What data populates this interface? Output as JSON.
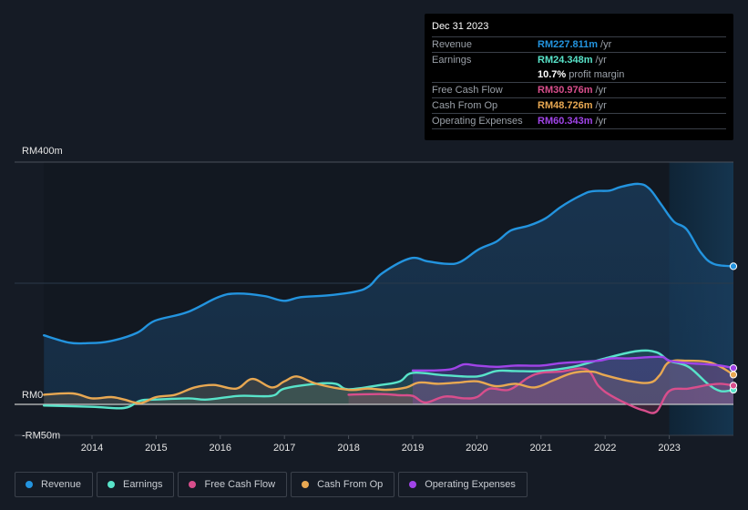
{
  "chart_data": {
    "type": "area",
    "title": "",
    "xlabel": "",
    "ylabel": "",
    "y_ticks": [
      {
        "value": 400,
        "label": "RM400m"
      },
      {
        "value": 0,
        "label": "RM0"
      },
      {
        "value": -50,
        "label": "-RM50m"
      }
    ],
    "ylim": [
      -50,
      400
    ],
    "xlim": [
      2013.3,
      2024.0
    ],
    "x_ticks": [
      "2014",
      "2015",
      "2016",
      "2017",
      "2018",
      "2019",
      "2020",
      "2021",
      "2022",
      "2023"
    ],
    "forecast_region_start": 2023.0,
    "grid": true,
    "legend_position": "bottom-left",
    "series": [
      {
        "name": "Revenue",
        "color": "#2394df",
        "x": [
          2013.25,
          2013.64,
          2013.92,
          2014.27,
          2014.7,
          2014.98,
          2015.48,
          2015.97,
          2016.26,
          2016.68,
          2016.99,
          2017.25,
          2017.68,
          2018.1,
          2018.32,
          2018.53,
          2018.96,
          2019.24,
          2019.53,
          2019.74,
          2020.03,
          2020.31,
          2020.53,
          2020.81,
          2021.07,
          2021.31,
          2021.64,
          2021.81,
          2022.07,
          2022.24,
          2022.52,
          2022.69,
          2022.88,
          2023.07,
          2023.27,
          2023.49,
          2023.69,
          2024.0
        ],
        "values": [
          114,
          102,
          101,
          104,
          118,
          138,
          152,
          177,
          183,
          179,
          171,
          177,
          180,
          186,
          195,
          217,
          241,
          236,
          232,
          235,
          256,
          269,
          287,
          295,
          307,
          326,
          346,
          352,
          353,
          359,
          364,
          356,
          329,
          302,
          289,
          251,
          232,
          228
        ]
      },
      {
        "name": "Earnings",
        "color": "#58e3c9",
        "x": [
          2013.25,
          2014.0,
          2014.5,
          2014.75,
          2015.0,
          2015.5,
          2015.8,
          2016.3,
          2016.8,
          2017.0,
          2017.5,
          2017.8,
          2018.0,
          2018.5,
          2018.8,
          2019.0,
          2019.5,
          2020.0,
          2020.3,
          2020.6,
          2021.0,
          2021.5,
          2022.0,
          2022.5,
          2022.8,
          2023.0,
          2023.3,
          2023.6,
          2023.8,
          2024.0
        ],
        "values": [
          -2,
          -4,
          -6,
          6,
          8,
          10,
          8,
          14,
          14,
          26,
          34,
          34,
          25,
          32,
          38,
          52,
          48,
          46,
          55,
          55,
          55,
          62,
          76,
          88,
          86,
          72,
          62,
          34,
          22,
          24
        ]
      },
      {
        "name": "Free Cash Flow",
        "color": "#d84e8c",
        "x": [
          2018.0,
          2018.5,
          2018.8,
          2019.0,
          2019.2,
          2019.5,
          2019.8,
          2020.0,
          2020.2,
          2020.5,
          2020.8,
          2021.0,
          2021.3,
          2021.7,
          2021.9,
          2022.1,
          2022.4,
          2022.6,
          2022.8,
          2023.0,
          2023.3,
          2023.6,
          2023.8,
          2024.0
        ],
        "values": [
          16,
          17,
          15,
          14,
          3,
          13,
          10,
          12,
          26,
          24,
          44,
          52,
          54,
          58,
          30,
          14,
          -2,
          -10,
          -12,
          22,
          26,
          32,
          34,
          31
        ]
      },
      {
        "name": "Cash From Op",
        "color": "#e8a852",
        "x": [
          2013.25,
          2013.7,
          2014.0,
          2014.3,
          2014.5,
          2014.75,
          2015.0,
          2015.3,
          2015.6,
          2015.9,
          2016.25,
          2016.5,
          2016.8,
          2017.0,
          2017.2,
          2017.5,
          2018.0,
          2018.3,
          2018.6,
          2018.9,
          2019.1,
          2019.4,
          2019.7,
          2020.0,
          2020.3,
          2020.6,
          2020.9,
          2021.2,
          2021.5,
          2021.8,
          2022.0,
          2022.4,
          2022.7,
          2022.85,
          2023.0,
          2023.3,
          2023.6,
          2023.8,
          2024.0
        ],
        "values": [
          16,
          18,
          10,
          12,
          8,
          2,
          12,
          16,
          28,
          32,
          26,
          42,
          28,
          38,
          46,
          34,
          24,
          26,
          24,
          28,
          36,
          34,
          36,
          38,
          30,
          34,
          28,
          40,
          52,
          54,
          48,
          38,
          36,
          48,
          70,
          72,
          70,
          62,
          49
        ]
      },
      {
        "name": "Operating Expenses",
        "color": "#a044e8",
        "x": [
          2019.0,
          2019.3,
          2019.6,
          2019.8,
          2020.0,
          2020.3,
          2020.6,
          2021.0,
          2021.3,
          2021.6,
          2021.9,
          2022.1,
          2022.4,
          2022.7,
          2022.9,
          2023.0,
          2023.3,
          2023.6,
          2023.8,
          2024.0
        ],
        "values": [
          56,
          56,
          58,
          66,
          64,
          62,
          64,
          64,
          68,
          70,
          72,
          76,
          76,
          78,
          78,
          72,
          68,
          66,
          64,
          60
        ]
      }
    ]
  },
  "tooltip": {
    "date": "Dec 31 2023",
    "rows": [
      {
        "label": "Revenue",
        "value": "RM227.811m",
        "unit": "/yr",
        "color": "#2394df"
      },
      {
        "label": "Earnings",
        "value": "RM24.348m",
        "unit": "/yr",
        "color": "#58e3c9"
      },
      {
        "label": "",
        "value": "10.7%",
        "unit": "profit margin",
        "color": "#ffffff"
      },
      {
        "label": "Free Cash Flow",
        "value": "RM30.976m",
        "unit": "/yr",
        "color": "#d84e8c"
      },
      {
        "label": "Cash From Op",
        "value": "RM48.726m",
        "unit": "/yr",
        "color": "#e8a852"
      },
      {
        "label": "Operating Expenses",
        "value": "RM60.343m",
        "unit": "/yr",
        "color": "#a044e8"
      }
    ]
  },
  "legend": [
    {
      "label": "Revenue",
      "color": "#2394df"
    },
    {
      "label": "Earnings",
      "color": "#58e3c9"
    },
    {
      "label": "Free Cash Flow",
      "color": "#d84e8c"
    },
    {
      "label": "Cash From Op",
      "color": "#e8a852"
    },
    {
      "label": "Operating Expenses",
      "color": "#a044e8"
    }
  ]
}
